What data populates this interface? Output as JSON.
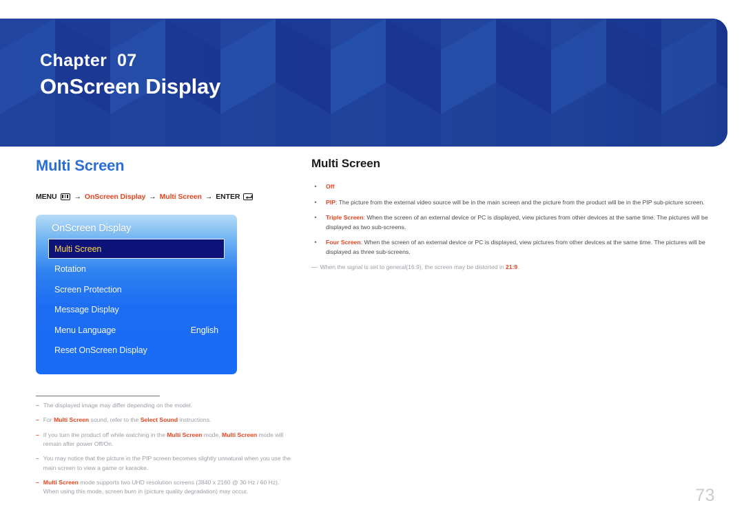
{
  "banner": {
    "kicker": "Chapter  07",
    "title": "OnScreen Display",
    "bg_color": "#1e3f9e"
  },
  "left": {
    "heading": "Multi Screen",
    "heading_color": "#2a6fd4",
    "menu_path": {
      "menu_label": "MENU",
      "menu_icon": "menu-grid-icon",
      "arrow1": "→",
      "step1": "OnScreen Display",
      "arrow2": "→",
      "step2": "Multi Screen",
      "arrow3": "→",
      "enter_label": "ENTER",
      "enter_icon": "enter-return-icon",
      "accent_color": "#e8431f"
    },
    "osd": {
      "title": "OnScreen Display",
      "items": [
        {
          "label": "Multi Screen",
          "value": "",
          "selected": true
        },
        {
          "label": "Rotation",
          "value": "",
          "selected": false
        },
        {
          "label": "Screen Protection",
          "value": "",
          "selected": false
        },
        {
          "label": "Message Display",
          "value": "",
          "selected": false
        },
        {
          "label": "Menu Language",
          "value": "English",
          "selected": false
        },
        {
          "label": "Reset OnScreen Display",
          "value": "",
          "selected": false
        }
      ],
      "selected_bg": "#0c1277",
      "selected_text": "#ffd84a"
    },
    "footnotes": [
      {
        "dash_gray": true,
        "parts": [
          {
            "t": "The displayed image may differ depending on the model.",
            "b": false
          }
        ]
      },
      {
        "dash_gray": false,
        "parts": [
          {
            "t": "For ",
            "b": false
          },
          {
            "t": "Multi Screen",
            "b": true
          },
          {
            "t": " sound, refer to the ",
            "b": false
          },
          {
            "t": "Select Sound",
            "b": true
          },
          {
            "t": " instructions.",
            "b": false
          }
        ]
      },
      {
        "dash_gray": false,
        "parts": [
          {
            "t": "If you turn the product off while watching in the ",
            "b": false
          },
          {
            "t": "Multi Screen",
            "b": true
          },
          {
            "t": " mode, ",
            "b": false
          },
          {
            "t": "Multi Screen",
            "b": true
          },
          {
            "t": " mode will remain after power Off/On.",
            "b": false
          }
        ]
      },
      {
        "dash_gray": true,
        "parts": [
          {
            "t": "You may notice that the picture in the PIP screen becomes slightly unnatural when you use the main screen to view a game or karaoke.",
            "b": false
          }
        ]
      },
      {
        "dash_gray": false,
        "parts": [
          {
            "t": "Multi Screen",
            "b": true
          },
          {
            "t": " mode supports two UHD resolution screens (3840 x 2160 @ 30 Hz / 60 Hz). When using this mode, screen burn in (picture quality degradation) may occur.",
            "b": false
          }
        ]
      }
    ]
  },
  "right": {
    "heading": "Multi Screen",
    "bullet_marker": "•",
    "bullets": [
      {
        "parts": [
          {
            "t": "Off",
            "b": true
          }
        ]
      },
      {
        "parts": [
          {
            "t": "PIP",
            "b": true
          },
          {
            "t": ": The picture from the external video source will be in the main screen and the picture from the product will be in the PIP sub-picture screen.",
            "b": false
          }
        ]
      },
      {
        "parts": [
          {
            "t": "Triple Screen",
            "b": true
          },
          {
            "t": ": When the screen of an external device or PC is displayed, view pictures from other devices at the same time. The pictures will be displayed as two sub-screens.",
            "b": false
          }
        ]
      },
      {
        "parts": [
          {
            "t": "Four Screen",
            "b": true
          },
          {
            "t": ": When the screen of an external device or PC is displayed, view pictures from other devices at the same time. The pictures will be displayed as three sub-screens.",
            "b": false
          }
        ]
      }
    ],
    "note": {
      "dash": "—",
      "parts": [
        {
          "t": "When the signal is set to general(16:9), the screen may be distorted in ",
          "b": false
        },
        {
          "t": "21:9",
          "b": true
        },
        {
          "t": ".",
          "b": false
        }
      ]
    }
  },
  "page_number": "73"
}
